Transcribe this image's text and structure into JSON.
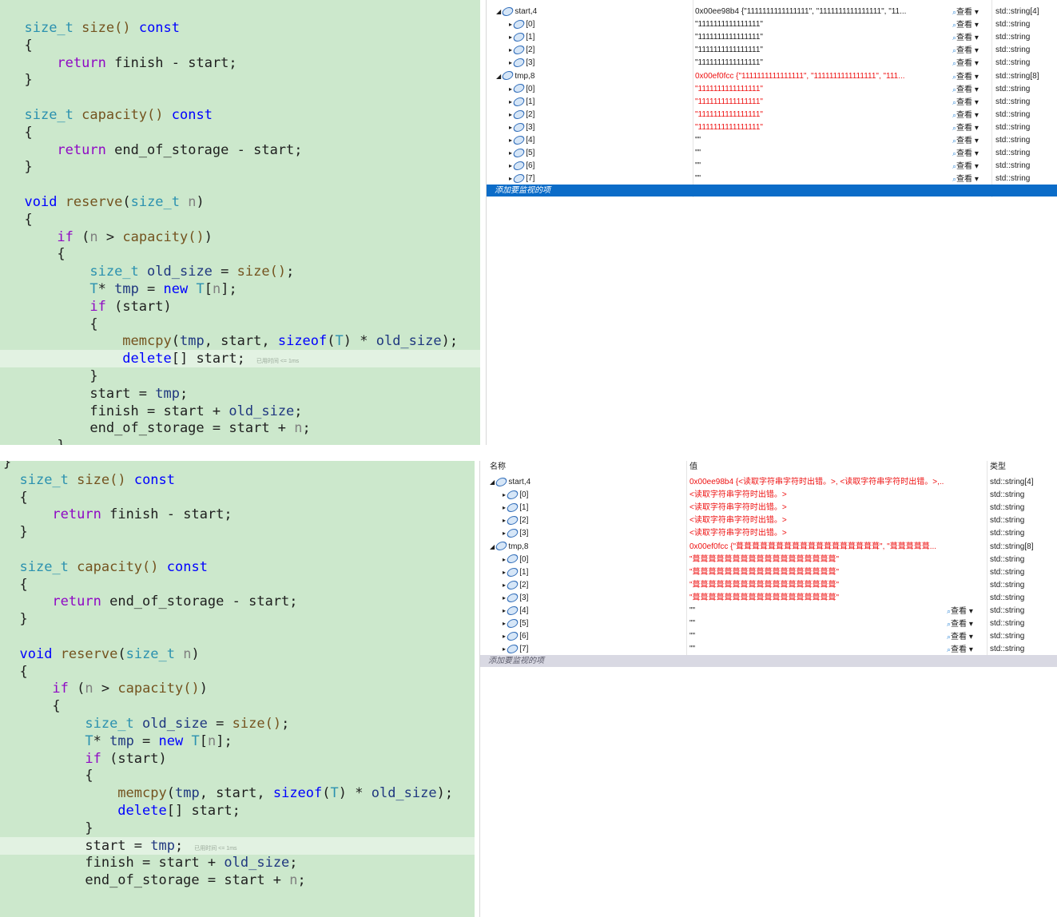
{
  "code_lines": {
    "size_fn": "size()",
    "const": "const",
    "return": "return",
    "finish": "finish",
    "start": "start",
    "size_t": "size_t",
    "capacity_fn": "capacity()",
    "end_of_storage": "end_of_storage",
    "void": "void",
    "reserve": "reserve",
    "n": "n",
    "if": "if",
    "old_size": "old_size",
    "T": "T",
    "tmp": "tmp",
    "new": "new",
    "memcpy": "memcpy",
    "sizeof": "sizeof",
    "delete": "delete"
  },
  "elapsed_label": "已用时间 <= 1ms",
  "watch_top": {
    "rows": [
      {
        "name": "start,4",
        "value": "0x00ee98b4 {\"1111111111111111\", \"1111111111111111\", \"11...",
        "type": "std::string[4]",
        "red": false,
        "root": true
      },
      {
        "name": "[0]",
        "value": "\"1111111111111111\"",
        "type": "std::string",
        "red": false
      },
      {
        "name": "[1]",
        "value": "\"1111111111111111\"",
        "type": "std::string",
        "red": false
      },
      {
        "name": "[2]",
        "value": "\"1111111111111111\"",
        "type": "std::string",
        "red": false
      },
      {
        "name": "[3]",
        "value": "\"1111111111111111\"",
        "type": "std::string",
        "red": false
      },
      {
        "name": "tmp,8",
        "value": "0x00ef0fcc {\"1111111111111111\", \"1111111111111111\", \"111...",
        "type": "std::string[8]",
        "red": true,
        "root": true
      },
      {
        "name": "[0]",
        "value": "\"1111111111111111\"",
        "type": "std::string",
        "red": true
      },
      {
        "name": "[1]",
        "value": "\"1111111111111111\"",
        "type": "std::string",
        "red": true
      },
      {
        "name": "[2]",
        "value": "\"1111111111111111\"",
        "type": "std::string",
        "red": true
      },
      {
        "name": "[3]",
        "value": "\"1111111111111111\"",
        "type": "std::string",
        "red": true
      },
      {
        "name": "[4]",
        "value": "\"\"",
        "type": "std::string",
        "red": false
      },
      {
        "name": "[5]",
        "value": "\"\"",
        "type": "std::string",
        "red": false
      },
      {
        "name": "[6]",
        "value": "\"\"",
        "type": "std::string",
        "red": false
      },
      {
        "name": "[7]",
        "value": "\"\"",
        "type": "std::string",
        "red": false
      }
    ],
    "view_label": "查看",
    "add_watch": "添加要监视的项"
  },
  "watch_bottom": {
    "header": {
      "name": "名称",
      "value": "值",
      "type": "类型"
    },
    "rows": [
      {
        "name": "start,4",
        "value": "0x00ee98b4 {<读取字符串字符时出错。>, <读取字符串字符时出错。>,...",
        "type": "std::string[4]",
        "red": true,
        "root": true,
        "view": false
      },
      {
        "name": "[0]",
        "value": "<读取字符串字符时出错。>",
        "type": "std::string",
        "red": true,
        "view": false
      },
      {
        "name": "[1]",
        "value": "<读取字符串字符时出错。>",
        "type": "std::string",
        "red": true,
        "view": false
      },
      {
        "name": "[2]",
        "value": "<读取字符串字符时出错。>",
        "type": "std::string",
        "red": true,
        "view": false
      },
      {
        "name": "[3]",
        "value": "<读取字符串字符时出错。>",
        "type": "std::string",
        "red": true,
        "view": false
      },
      {
        "name": "tmp,8",
        "value": "0x00ef0fcc {\"葺葺葺葺葺葺葺葺葺葺葺葺葺葺葺葺葺葺\", \"葺葺葺葺葺...",
        "type": "std::string[8]",
        "red": true,
        "root": true,
        "view": false
      },
      {
        "name": "[0]",
        "value": "\"葺葺葺葺葺葺葺葺葺葺葺葺葺葺葺葺葺葺\"",
        "type": "std::string",
        "red": true,
        "view": false
      },
      {
        "name": "[1]",
        "value": "\"葺葺葺葺葺葺葺葺葺葺葺葺葺葺葺葺葺葺\"",
        "type": "std::string",
        "red": true,
        "view": false
      },
      {
        "name": "[2]",
        "value": "\"葺葺葺葺葺葺葺葺葺葺葺葺葺葺葺葺葺葺\"",
        "type": "std::string",
        "red": true,
        "view": false
      },
      {
        "name": "[3]",
        "value": "\"葺葺葺葺葺葺葺葺葺葺葺葺葺葺葺葺葺葺\"",
        "type": "std::string",
        "red": true,
        "view": false
      },
      {
        "name": "[4]",
        "value": "\"\"",
        "type": "std::string",
        "red": false,
        "view": true
      },
      {
        "name": "[5]",
        "value": "\"\"",
        "type": "std::string",
        "red": false,
        "view": true
      },
      {
        "name": "[6]",
        "value": "\"\"",
        "type": "std::string",
        "red": false,
        "view": true
      },
      {
        "name": "[7]",
        "value": "\"\"",
        "type": "std::string",
        "red": false,
        "view": true
      }
    ],
    "view_label": "查看",
    "add_watch": "添加要监视的项"
  },
  "colors": {
    "code_bg": "#cce8cc",
    "keyword": "#0000ff",
    "type": "#2b91af",
    "error_text": "#ee1111",
    "selection": "#0b6cc8"
  },
  "icons": [
    "expand-arrow-icon",
    "watch-variable-icon",
    "magnifier-icon",
    "dropdown-icon"
  ]
}
